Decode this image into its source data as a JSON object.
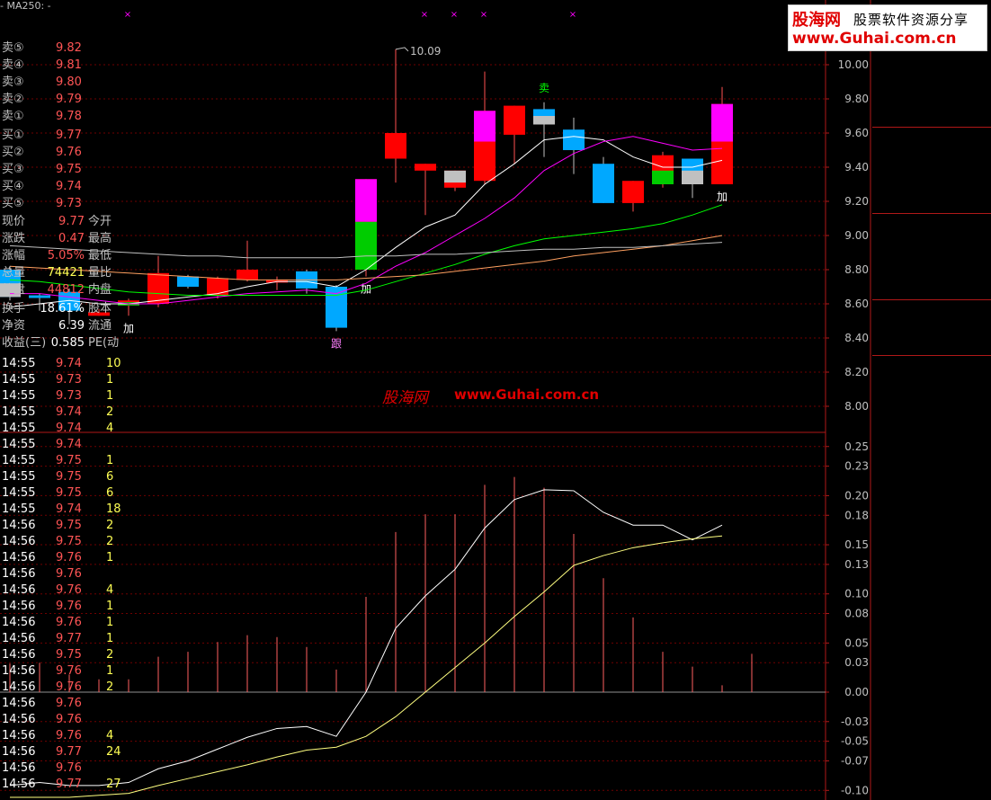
{
  "legend": {
    "ma_label": "MA250: -",
    "prefix": "- "
  },
  "watermark": {
    "brand": "股海网",
    "url": "www.Guhai.com.cn"
  },
  "banner": {
    "brand": "股海网",
    "slogan": "股票软件资源分享",
    "url": "www.Guhai.com.cn"
  },
  "colors": {
    "up": "#ff0000",
    "down": "#00a8ff",
    "grid": "#800000",
    "ma5": "#ffffff",
    "ma10": "#ff00ff",
    "ma20": "#00ff00",
    "ma60": "#ffa060",
    "ma250": "#c0c0c0"
  },
  "order_book": {
    "sell": [
      {
        "label": "卖⑤",
        "price": "9.82"
      },
      {
        "label": "卖④",
        "price": "9.81"
      },
      {
        "label": "卖③",
        "price": "9.80"
      },
      {
        "label": "卖②",
        "price": "9.79"
      },
      {
        "label": "卖①",
        "price": "9.78"
      }
    ],
    "buy": [
      {
        "label": "买①",
        "price": "9.77"
      },
      {
        "label": "买②",
        "price": "9.76"
      },
      {
        "label": "买③",
        "price": "9.75"
      },
      {
        "label": "买④",
        "price": "9.74"
      },
      {
        "label": "买⑤",
        "price": "9.73"
      }
    ]
  },
  "quote": [
    {
      "label": "现价",
      "value": "9.77",
      "label2": "今开"
    },
    {
      "label": "涨跌",
      "value": "0.47",
      "label2": "最高"
    },
    {
      "label": "涨幅",
      "value": "5.05%",
      "label2": "最低"
    },
    {
      "label": "总量",
      "value": "74421",
      "label2": "量比"
    },
    {
      "label": "外盘",
      "value": "44812",
      "label2": "内盘"
    },
    {
      "label": "换手",
      "value": "18.61%",
      "label2": "股本"
    },
    {
      "label": "净资",
      "value": "6.39",
      "label2": "流通"
    },
    {
      "label": "收益(三)",
      "value": "0.585",
      "label2": "PE(动"
    }
  ],
  "ticks": [
    {
      "time": "14:55",
      "price": "9.74",
      "vol": "10"
    },
    {
      "time": "14:55",
      "price": "9.73",
      "vol": "1"
    },
    {
      "time": "14:55",
      "price": "9.73",
      "vol": "1"
    },
    {
      "time": "14:55",
      "price": "9.74",
      "vol": "2"
    },
    {
      "time": "14:55",
      "price": "9.74",
      "vol": "4"
    },
    {
      "time": "14:55",
      "price": "9.74",
      "vol": ""
    },
    {
      "time": "14:55",
      "price": "9.75",
      "vol": "1"
    },
    {
      "time": "14:55",
      "price": "9.75",
      "vol": "6"
    },
    {
      "time": "14:55",
      "price": "9.75",
      "vol": "6"
    },
    {
      "time": "14:55",
      "price": "9.74",
      "vol": "18"
    },
    {
      "time": "14:56",
      "price": "9.75",
      "vol": "2"
    },
    {
      "time": "14:56",
      "price": "9.75",
      "vol": "2"
    },
    {
      "time": "14:56",
      "price": "9.76",
      "vol": "1"
    },
    {
      "time": "14:56",
      "price": "9.76",
      "vol": ""
    },
    {
      "time": "14:56",
      "price": "9.76",
      "vol": "4"
    },
    {
      "time": "14:56",
      "price": "9.76",
      "vol": "1"
    },
    {
      "time": "14:56",
      "price": "9.76",
      "vol": "1"
    },
    {
      "time": "14:56",
      "price": "9.77",
      "vol": "1"
    },
    {
      "time": "14:56",
      "price": "9.75",
      "vol": "2"
    },
    {
      "time": "14:56",
      "price": "9.76",
      "vol": "1"
    },
    {
      "time": "14:56",
      "price": "9.76",
      "vol": "2"
    },
    {
      "time": "14:56",
      "price": "9.76",
      "vol": ""
    },
    {
      "time": "14:56",
      "price": "9.76",
      "vol": ""
    },
    {
      "time": "14:56",
      "price": "9.76",
      "vol": "4"
    },
    {
      "time": "14:56",
      "price": "9.77",
      "vol": "24"
    },
    {
      "time": "14:56",
      "price": "9.76",
      "vol": ""
    },
    {
      "time": "14:56",
      "price": "9.77",
      "vol": "27"
    }
  ],
  "chart_data": [
    {
      "type": "candlestick",
      "title": "",
      "ylim": [
        7.9,
        10.1
      ],
      "y_ticks": [
        "10.00",
        "9.80",
        "9.60",
        "9.40",
        "9.20",
        "9.00",
        "8.80",
        "8.60",
        "8.40",
        "8.20",
        "8.00"
      ],
      "candles": [
        {
          "open": 8.8,
          "close": 8.64,
          "high": 8.82,
          "low": 8.62
        },
        {
          "open": 8.65,
          "close": 8.64,
          "high": 8.66,
          "low": 8.56
        },
        {
          "open": 8.67,
          "close": 8.56,
          "high": 8.69,
          "low": 8.48
        },
        {
          "open": 8.53,
          "close": 8.55,
          "high": 8.57,
          "low": 8.53
        },
        {
          "open": 8.59,
          "close": 8.62,
          "high": 8.63,
          "low": 8.53
        },
        {
          "open": 8.6,
          "close": 8.78,
          "high": 8.88,
          "low": 8.58
        },
        {
          "open": 8.76,
          "close": 8.7,
          "high": 8.77,
          "low": 8.69
        },
        {
          "open": 8.65,
          "close": 8.75,
          "high": 8.76,
          "low": 8.63
        },
        {
          "open": 8.74,
          "close": 8.8,
          "high": 8.97,
          "low": 8.73
        },
        {
          "open": 8.73,
          "close": 8.74,
          "high": 8.76,
          "low": 8.68
        },
        {
          "open": 8.79,
          "close": 8.69,
          "high": 8.8,
          "low": 8.66
        },
        {
          "open": 8.7,
          "close": 8.46,
          "high": 8.71,
          "low": 8.44
        },
        {
          "open": 8.8,
          "close": 9.33,
          "high": 9.33,
          "low": 8.76
        },
        {
          "open": 9.45,
          "close": 9.6,
          "high": 10.09,
          "low": 9.31
        },
        {
          "open": 9.38,
          "close": 9.42,
          "high": 9.42,
          "low": 9.12
        },
        {
          "open": 9.28,
          "close": 9.38,
          "high": 9.38,
          "low": 9.26
        },
        {
          "open": 9.32,
          "close": 9.73,
          "high": 9.96,
          "low": 9.3
        },
        {
          "open": 9.59,
          "close": 9.76,
          "high": 9.76,
          "low": 9.42
        },
        {
          "open": 9.74,
          "close": 9.65,
          "high": 9.78,
          "low": 9.46
        },
        {
          "open": 9.62,
          "close": 9.5,
          "high": 9.69,
          "low": 9.36
        },
        {
          "open": 9.42,
          "close": 9.19,
          "high": 9.46,
          "low": 9.19
        },
        {
          "open": 9.19,
          "close": 9.32,
          "high": 9.32,
          "low": 9.14
        },
        {
          "open": 9.33,
          "close": 9.47,
          "high": 9.49,
          "low": 9.28
        },
        {
          "open": 9.45,
          "close": 9.3,
          "high": 9.45,
          "low": 9.22
        },
        {
          "open": 9.3,
          "close": 9.77,
          "high": 9.87,
          "low": 9.3
        }
      ],
      "high_marker": "10.09",
      "signals": [
        {
          "index": 4,
          "text": "加",
          "below": true
        },
        {
          "index": 11,
          "text": "跟",
          "below": true
        },
        {
          "index": 12,
          "text": "加",
          "below": true
        },
        {
          "index": 18,
          "text": "卖",
          "below": false
        },
        {
          "index": 24,
          "text": "加",
          "below": true
        }
      ],
      "series": [
        {
          "key": "ma5",
          "values": [
            8.58,
            8.6,
            8.62,
            8.6,
            8.6,
            8.62,
            8.64,
            8.66,
            8.7,
            8.73,
            8.73,
            8.7,
            8.8,
            8.93,
            9.05,
            9.12,
            9.3,
            9.42,
            9.56,
            9.58,
            9.56,
            9.46,
            9.4,
            9.4,
            9.44
          ]
        },
        {
          "key": "ma10",
          "values": [
            8.66,
            8.66,
            8.64,
            8.62,
            8.6,
            8.6,
            8.62,
            8.64,
            8.66,
            8.67,
            8.68,
            8.66,
            8.72,
            8.82,
            8.9,
            9.0,
            9.1,
            9.22,
            9.38,
            9.48,
            9.55,
            9.58,
            9.54,
            9.5,
            9.51
          ]
        },
        {
          "key": "ma20",
          "values": [
            8.74,
            8.73,
            8.71,
            8.69,
            8.67,
            8.66,
            8.65,
            8.65,
            8.65,
            8.65,
            8.65,
            8.65,
            8.68,
            8.73,
            8.78,
            8.83,
            8.89,
            8.94,
            8.98,
            9.0,
            9.02,
            9.04,
            9.07,
            9.12,
            9.18
          ]
        },
        {
          "key": "ma60",
          "values": [
            8.82,
            8.81,
            8.8,
            8.79,
            8.78,
            8.77,
            8.76,
            8.75,
            8.74,
            8.74,
            8.74,
            8.74,
            8.75,
            8.76,
            8.77,
            8.79,
            8.81,
            8.83,
            8.85,
            8.88,
            8.9,
            8.92,
            8.94,
            8.97,
            9.0
          ]
        },
        {
          "key": "ma250",
          "values": [
            8.94,
            8.93,
            8.92,
            8.91,
            8.9,
            8.89,
            8.88,
            8.88,
            8.87,
            8.87,
            8.87,
            8.87,
            8.88,
            8.88,
            8.89,
            8.89,
            8.9,
            8.91,
            8.92,
            8.92,
            8.93,
            8.93,
            8.94,
            8.95,
            8.96
          ]
        }
      ]
    },
    {
      "type": "line",
      "title": "",
      "ylim": [
        -0.11,
        0.265
      ],
      "y_ticks": [
        "0.25",
        "0.23",
        "0.20",
        "0.18",
        "0.15",
        "0.13",
        "0.10",
        "0.08",
        "0.05",
        "0.03",
        "0.00",
        "-0.03",
        "-0.05",
        "-0.07",
        "-0.10"
      ],
      "bars": [
        0.029,
        0.03,
        0.018,
        0.013,
        0.013,
        0.036,
        0.041,
        0.051,
        0.058,
        0.056,
        0.046,
        0.023,
        0.097,
        0.163,
        0.181,
        0.181,
        0.211,
        0.219,
        0.208,
        0.161,
        0.116,
        0.076,
        0.041,
        0.026,
        0.007,
        0.039
      ],
      "series": [
        {
          "key": "white",
          "values": [
            -0.095,
            -0.092,
            -0.095,
            -0.095,
            -0.092,
            -0.078,
            -0.07,
            -0.058,
            -0.046,
            -0.037,
            -0.035,
            -0.045,
            0.0,
            0.065,
            0.098,
            0.125,
            0.167,
            0.196,
            0.206,
            0.205,
            0.183,
            0.17,
            0.17,
            0.155,
            0.17
          ]
        },
        {
          "key": "yellow",
          "values": [
            -0.107,
            -0.107,
            -0.107,
            -0.105,
            -0.103,
            -0.095,
            -0.088,
            -0.081,
            -0.074,
            -0.066,
            -0.059,
            -0.056,
            -0.045,
            -0.025,
            0.0,
            0.025,
            0.05,
            0.077,
            0.102,
            0.129,
            0.139,
            0.147,
            0.152,
            0.156,
            0.159
          ]
        }
      ]
    }
  ]
}
